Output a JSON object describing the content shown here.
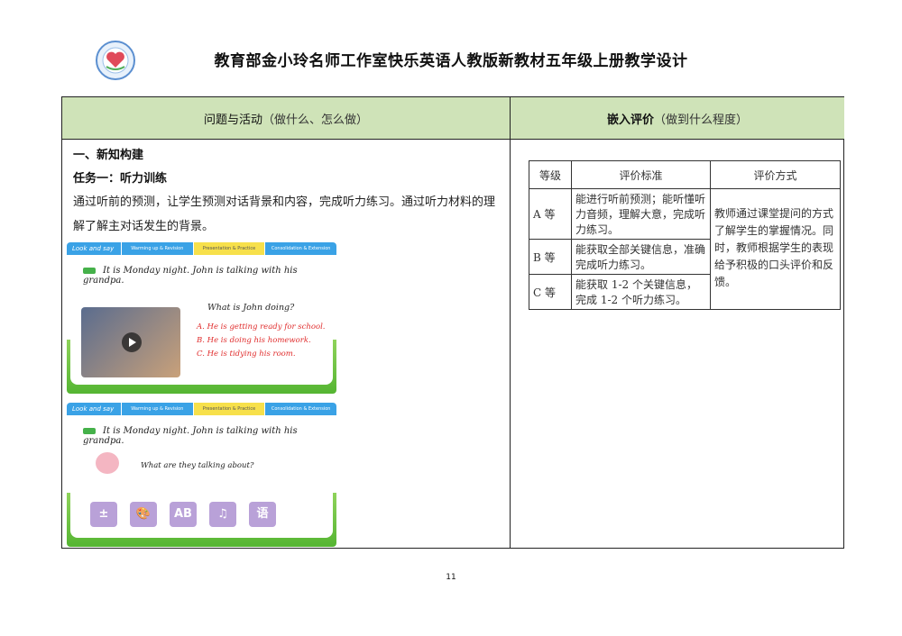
{
  "header": {
    "title": "教育部金小玲名师工作室快乐英语人教版新教材五年级上册教学设计"
  },
  "table": {
    "left_head_bold": "问题与活动",
    "left_head_sub": "（做什么、怎么做）",
    "right_head_bold": "嵌入评价",
    "right_head_sub": "（做到什么程度）"
  },
  "content": {
    "section": "一、新知构建",
    "task": "任务一：听力训练",
    "paragraph": "通过听前的预测，让学生预测对话背景和内容，完成听力练习。通过听力材料的理解了解主对话发生的背景。"
  },
  "slide1": {
    "tabs": [
      "Look and say",
      "Warming up & Revision",
      "Presentation & Practice",
      "Consolidation & Extension"
    ],
    "sentence": "It is Monday night. John is talking with his grandpa.",
    "question": "What is John doing?",
    "options": [
      "A. He is getting ready for school.",
      "B. He is doing his homework.",
      "C. He is tidying his room."
    ]
  },
  "slide2": {
    "tabs": [
      "Look and say",
      "Warming up & Revision",
      "Presentation & Practice",
      "Consolidation & Extension"
    ],
    "sentence": "It is Monday night. John is talking with his grandpa.",
    "question": "What are they talking about?",
    "subjects": [
      "math-icon",
      "art-icon",
      "english-icon",
      "music-icon",
      "chinese-icon"
    ],
    "subject_glyphs": [
      "±",
      "🎨",
      "AB",
      "♫",
      "语"
    ]
  },
  "evaluation": {
    "headers": [
      "等级",
      "评价标准",
      "评价方式"
    ],
    "rows": [
      {
        "grade": "A 等",
        "criteria": "能进行听前预测；能听懂听力音频，理解大意，完成听力练习。"
      },
      {
        "grade": "B 等",
        "criteria": "能获取全部关键信息，准确完成听力练习。"
      },
      {
        "grade": "C 等",
        "criteria": "能获取 1-2 个关键信息，完成 1-2 个听力练习。"
      }
    ],
    "method": "教师通过课堂提问的方式了解学生的掌握情况。同时，教师根据学生的表现给予积极的口头评价和反馈。"
  },
  "footer": {
    "page_number": "11"
  },
  "colors": {
    "header_green": "#cfe3b8",
    "slide_blue": "#3aa2e6",
    "answer_red": "#e02d2d",
    "grass_green": "#55b532"
  }
}
